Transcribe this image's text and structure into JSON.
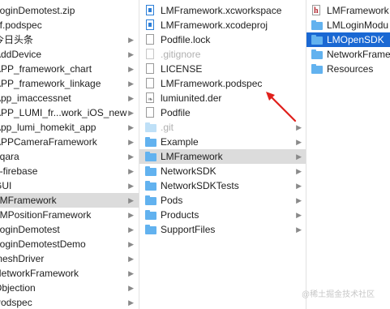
{
  "col1": {
    "items": [
      {
        "label": "LoginDemotest.zip",
        "chevron": false
      },
      {
        "label": "Lf.podspec",
        "chevron": false
      },
      {
        "label": "今日头条",
        "chevron": true
      },
      {
        "label": "AddDevice",
        "chevron": true
      },
      {
        "label": "APP_framework_chart",
        "chevron": true
      },
      {
        "label": "APP_framework_linkage",
        "chevron": true
      },
      {
        "label": "App_imaccessnet",
        "chevron": true
      },
      {
        "label": "APP_LUMI_fr...work_iOS_new",
        "chevron": true
      },
      {
        "label": "App_lumi_homekit_app",
        "chevron": true
      },
      {
        "label": "APPCameraFramework",
        "chevron": true
      },
      {
        "label": "aqara",
        "chevron": true
      },
      {
        "label": "g-firebase",
        "chevron": true
      },
      {
        "label": "GUI",
        "chevron": true
      },
      {
        "label": "LMFramework",
        "chevron": true,
        "selected": true
      },
      {
        "label": "LMPositionFramework",
        "chevron": true
      },
      {
        "label": "LoginDemotest",
        "chevron": true
      },
      {
        "label": "LoginDemotestDemo",
        "chevron": true
      },
      {
        "label": "meshDriver",
        "chevron": true
      },
      {
        "label": "NetworkFramework",
        "chevron": true
      },
      {
        "label": "Objection",
        "chevron": true
      },
      {
        "label": "Podspec",
        "chevron": true
      }
    ]
  },
  "col2": {
    "items": [
      {
        "label": "LMFramework.xcworkspace",
        "icon": "workspace-doc-icon",
        "kind": "doc-blue",
        "chevron": false
      },
      {
        "label": "LMFramework.xcodeproj",
        "icon": "xcodeproj-icon",
        "kind": "doc-blue",
        "chevron": false
      },
      {
        "label": "Podfile.lock",
        "icon": "document-icon",
        "kind": "doc",
        "chevron": false
      },
      {
        "label": ".gitignore",
        "icon": "document-icon",
        "kind": "doc-light",
        "chevron": false,
        "dim": true
      },
      {
        "label": "LICENSE",
        "icon": "document-icon",
        "kind": "doc",
        "chevron": false
      },
      {
        "label": "LMFramework.podspec",
        "icon": "document-icon",
        "kind": "doc",
        "chevron": false
      },
      {
        "label": "lumiunited.der",
        "icon": "certificate-icon",
        "kind": "doc-der",
        "chevron": false
      },
      {
        "label": "Podfile",
        "icon": "document-icon",
        "kind": "doc",
        "chevron": false
      },
      {
        "label": ".git",
        "icon": "folder-icon",
        "kind": "folder-light",
        "chevron": true,
        "dim": true
      },
      {
        "label": "Example",
        "icon": "folder-icon",
        "kind": "folder",
        "chevron": true
      },
      {
        "label": "LMFramework",
        "icon": "folder-icon",
        "kind": "folder",
        "chevron": true,
        "selected": true
      },
      {
        "label": "NetworkSDK",
        "icon": "folder-icon",
        "kind": "folder",
        "chevron": true
      },
      {
        "label": "NetworkSDKTests",
        "icon": "folder-icon",
        "kind": "folder",
        "chevron": true
      },
      {
        "label": "Pods",
        "icon": "folder-icon",
        "kind": "folder",
        "chevron": true
      },
      {
        "label": "Products",
        "icon": "folder-icon",
        "kind": "folder",
        "chevron": true
      },
      {
        "label": "SupportFiles",
        "icon": "folder-icon",
        "kind": "folder",
        "chevron": true
      }
    ]
  },
  "col3": {
    "items": [
      {
        "label": "LMFramework",
        "icon": "header-file-icon",
        "kind": "doc-header"
      },
      {
        "label": "LMLoginModu",
        "icon": "folder-icon",
        "kind": "folder"
      },
      {
        "label": "LMOpenSDK",
        "icon": "folder-icon",
        "kind": "folder",
        "selected": true
      },
      {
        "label": "NetworkFrame",
        "icon": "folder-icon",
        "kind": "folder"
      },
      {
        "label": "Resources",
        "icon": "folder-icon",
        "kind": "folder"
      }
    ]
  },
  "annotation": {
    "icon": "red-arrow-icon",
    "color": "#e0201c"
  },
  "watermark": "@稀土掘金技术社区"
}
